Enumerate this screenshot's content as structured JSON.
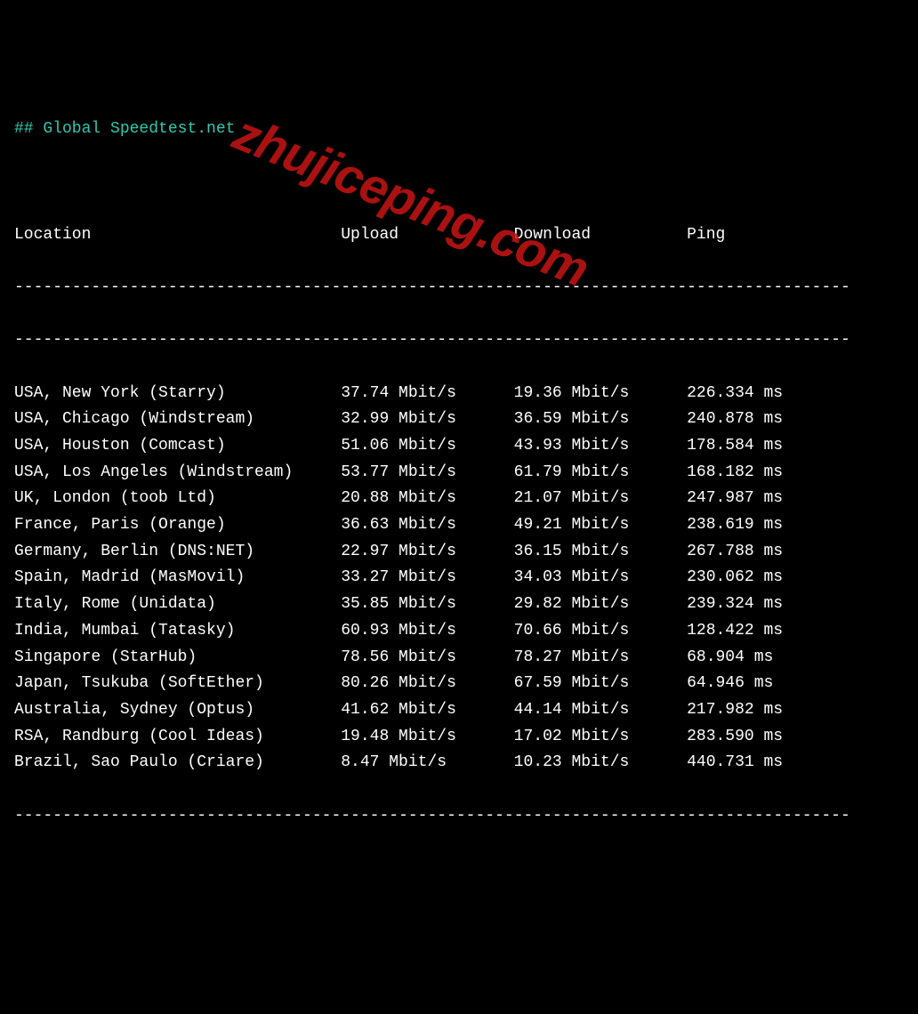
{
  "title": "## Global Speedtest.net",
  "columns": {
    "location": "Location",
    "upload": "Upload",
    "download": "Download",
    "ping": "Ping"
  },
  "divider": "---------------------------------------------------------------------------------------",
  "rows": [
    {
      "location": "USA, New York (Starry)",
      "upload": "37.74 Mbit/s",
      "download": "19.36 Mbit/s",
      "ping": "226.334 ms"
    },
    {
      "location": "USA, Chicago (Windstream)",
      "upload": "32.99 Mbit/s",
      "download": "36.59 Mbit/s",
      "ping": "240.878 ms"
    },
    {
      "location": "USA, Houston (Comcast)",
      "upload": "51.06 Mbit/s",
      "download": "43.93 Mbit/s",
      "ping": "178.584 ms"
    },
    {
      "location": "USA, Los Angeles (Windstream)",
      "upload": "53.77 Mbit/s",
      "download": "61.79 Mbit/s",
      "ping": "168.182 ms"
    },
    {
      "location": "UK, London (toob Ltd)",
      "upload": "20.88 Mbit/s",
      "download": "21.07 Mbit/s",
      "ping": "247.987 ms"
    },
    {
      "location": "France, Paris (Orange)",
      "upload": "36.63 Mbit/s",
      "download": "49.21 Mbit/s",
      "ping": "238.619 ms"
    },
    {
      "location": "Germany, Berlin (DNS:NET)",
      "upload": "22.97 Mbit/s",
      "download": "36.15 Mbit/s",
      "ping": "267.788 ms"
    },
    {
      "location": "Spain, Madrid (MasMovil)",
      "upload": "33.27 Mbit/s",
      "download": "34.03 Mbit/s",
      "ping": "230.062 ms"
    },
    {
      "location": "Italy, Rome (Unidata)",
      "upload": "35.85 Mbit/s",
      "download": "29.82 Mbit/s",
      "ping": "239.324 ms"
    },
    {
      "location": "India, Mumbai (Tatasky)",
      "upload": "60.93 Mbit/s",
      "download": "70.66 Mbit/s",
      "ping": "128.422 ms"
    },
    {
      "location": "Singapore (StarHub)",
      "upload": "78.56 Mbit/s",
      "download": "78.27 Mbit/s",
      "ping": "68.904 ms"
    },
    {
      "location": "Japan, Tsukuba (SoftEther)",
      "upload": "80.26 Mbit/s",
      "download": "67.59 Mbit/s",
      "ping": "64.946 ms"
    },
    {
      "location": "Australia, Sydney (Optus)",
      "upload": "41.62 Mbit/s",
      "download": "44.14 Mbit/s",
      "ping": "217.982 ms"
    },
    {
      "location": "RSA, Randburg (Cool Ideas)",
      "upload": "19.48 Mbit/s",
      "download": "17.02 Mbit/s",
      "ping": "283.590 ms"
    },
    {
      "location": "Brazil, Sao Paulo (Criare)",
      "upload": "8.47 Mbit/s",
      "download": "10.23 Mbit/s",
      "ping": "440.731 ms"
    }
  ],
  "watermark": "zhujiceping.com"
}
